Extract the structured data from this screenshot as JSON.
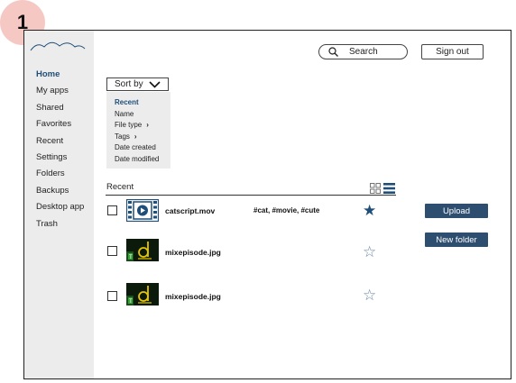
{
  "step_badge": "1",
  "logo": {
    "icon": "cloud-icon"
  },
  "sidebar": {
    "items": [
      {
        "label": "Home",
        "active": true
      },
      {
        "label": "My apps"
      },
      {
        "label": "Shared"
      },
      {
        "label": "Favorites"
      },
      {
        "label": "Recent"
      },
      {
        "label": "Settings"
      },
      {
        "label": "Folders"
      },
      {
        "label": "Backups"
      },
      {
        "label": "Desktop app"
      },
      {
        "label": "Trash"
      }
    ]
  },
  "header": {
    "search_label": "Search",
    "signout_label": "Sign out"
  },
  "sort": {
    "button_label": "Sort by",
    "options": [
      "Recent",
      "Name",
      "File type",
      "Tags",
      "Date created",
      "Date modified"
    ],
    "selected": "Recent"
  },
  "list": {
    "title": "Recent",
    "rows": [
      {
        "name": "catscript.mov",
        "tags": "#cat, #movie, #cute",
        "starred": true,
        "thumb": "video-icon"
      },
      {
        "name": "mixepisode.jpg",
        "tags": "",
        "starred": false,
        "thumb": "image-thumbnail"
      },
      {
        "name": "mixepisode.jpg",
        "tags": "",
        "starred": false,
        "thumb": "image-thumbnail"
      }
    ]
  },
  "actions": {
    "upload_label": "Upload",
    "new_folder_label": "New folder"
  },
  "colors": {
    "accent": "#1f4e79",
    "button": "#2e4e6f",
    "sidebar_bg": "#ececec",
    "badge": "#f6c8c4"
  }
}
